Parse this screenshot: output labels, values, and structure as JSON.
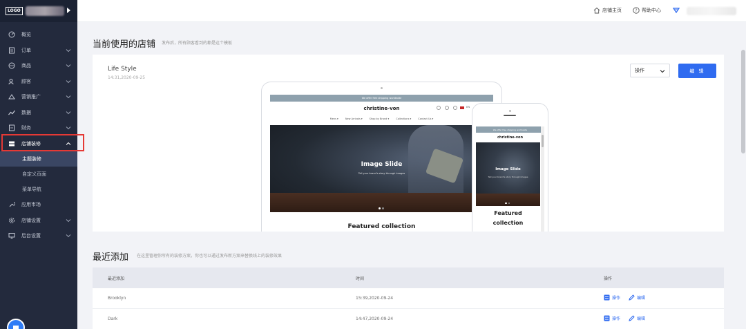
{
  "app": {
    "logo_text": "LOGO"
  },
  "sidebar": {
    "items": [
      {
        "label": "概览"
      },
      {
        "label": "订单"
      },
      {
        "label": "商品"
      },
      {
        "label": "顾客"
      },
      {
        "label": "营销推广"
      },
      {
        "label": "数据"
      },
      {
        "label": "财务"
      },
      {
        "label": "店铺装修"
      },
      {
        "label": "应用市场"
      },
      {
        "label": "店铺设置"
      },
      {
        "label": "后台设置"
      }
    ],
    "submenu": [
      {
        "label": "主题装修",
        "active": true
      },
      {
        "label": "自定义页面",
        "active": false
      },
      {
        "label": "菜单导航",
        "active": false
      }
    ]
  },
  "topbar": {
    "store_home": "店铺主页",
    "help_center": "帮助中心"
  },
  "current_theme": {
    "section_title": "当前使用的店铺",
    "section_desc": "发布后，所有顾客看到的都是这个模板",
    "theme_name": "Life Style",
    "theme_time": "14:31,2020-09-25",
    "select_value": "操作",
    "edit_label": "编 辑"
  },
  "preview": {
    "promo": "We offer free shipping worldwide",
    "brand": "christine-von",
    "nav": [
      "Mens ▾",
      "New Arrivals ▾",
      "Shop by Brand ▾",
      "Collections ▾",
      "Contact Us ▾"
    ],
    "flag_text": "EN",
    "hero_title": "Image Slide",
    "hero_sub": "Tell your brand's story through images",
    "featured": "Featured collection",
    "phone_featured_line1": "Featured",
    "phone_featured_line2": "collection"
  },
  "recent": {
    "section_title": "最近添加",
    "section_desc": "在这里管理你所有的装修方案，你也可以通过发布新方案来替换线上的装修效果",
    "headers": [
      "最近添加",
      "时间",
      "操作"
    ],
    "rows": [
      {
        "name": "Brooklyn",
        "time": "15:39,2020-09-24",
        "op_label": "操作",
        "edit_label": "编辑"
      },
      {
        "name": "Dark",
        "time": "14:47,2020-09-24",
        "op_label": "操作",
        "edit_label": "编辑"
      }
    ]
  },
  "colors": {
    "sidebar_bg": "#232a3d",
    "accent": "#2f6bf0",
    "highlight": "#e53935"
  }
}
